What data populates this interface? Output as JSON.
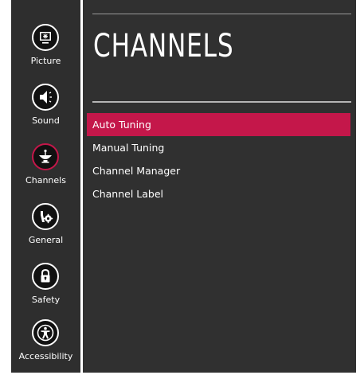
{
  "sidebar": {
    "items": [
      {
        "label": "Picture",
        "icon": "monitor-icon"
      },
      {
        "label": "Sound",
        "icon": "speaker-icon"
      },
      {
        "label": "Channels",
        "icon": "satellite-dish-icon",
        "active": true
      },
      {
        "label": "General",
        "icon": "tools-gear-icon"
      },
      {
        "label": "Safety",
        "icon": "lock-icon"
      },
      {
        "label": "Accessibility",
        "icon": "accessibility-person-icon"
      }
    ]
  },
  "main": {
    "title": "CHANNELS",
    "menu": [
      {
        "label": "Auto Tuning",
        "selected": true
      },
      {
        "label": "Manual Tuning"
      },
      {
        "label": "Channel Manager"
      },
      {
        "label": "Channel Label"
      }
    ]
  },
  "colors": {
    "accent": "#c4174a",
    "sidebar_bg": "#2e2e2e",
    "content_bg": "#303030",
    "icon_bg": "#111111"
  }
}
